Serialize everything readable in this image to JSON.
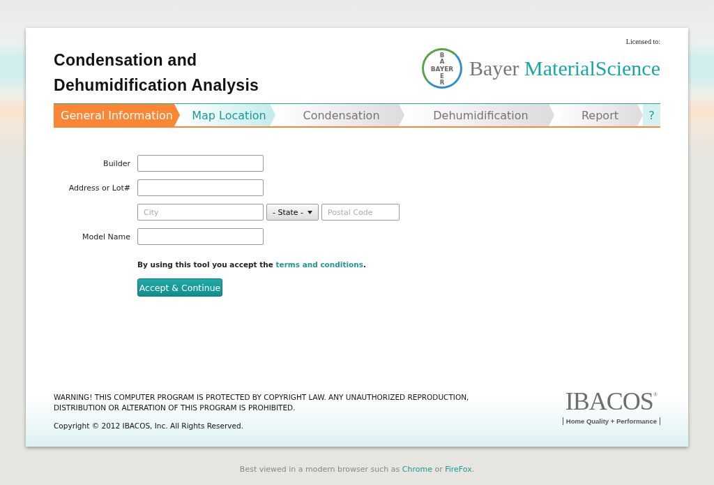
{
  "header": {
    "title_lines": [
      "Condensation and",
      "Dehumidification Analysis"
    ],
    "licensed": "Licensed to:",
    "logo": {
      "horizontal": "BAYER",
      "vertical_top": "BA",
      "vertical_bottom": "ER",
      "brand": "Bayer",
      "brand_accent": "MaterialScience"
    }
  },
  "tabs": [
    {
      "label": "General Information",
      "selected": true,
      "available": true
    },
    {
      "label": "Map Location",
      "selected": false,
      "available": true
    },
    {
      "label": "Condensation",
      "selected": false,
      "available": false
    },
    {
      "label": "Dehumidification",
      "selected": false,
      "available": false
    },
    {
      "label": "Report",
      "selected": false,
      "available": false
    }
  ],
  "help": "?",
  "form": {
    "rows": [
      {
        "kind": "text",
        "label": "Builder"
      },
      {
        "kind": "text",
        "label": "Address or Lot#"
      },
      {
        "kind": "location",
        "city": {
          "placeholder": "City"
        },
        "state": "- State -",
        "postal": {
          "placeholder": "Postal Code"
        }
      },
      {
        "kind": "text",
        "label": "Model Name"
      }
    ],
    "terms": {
      "before": "By using this tool you accept the",
      "link": "terms and conditions",
      "after": "."
    },
    "button": "Accept & Continue"
  },
  "footer": {
    "warning": "WARNING! THIS COMPUTER PROGRAM IS PROTECTED BY COPYRIGHT LAW. ANY UNAUTHORIZED REPRODUCTION, DISTRIBUTION OR ALTERATION OF THIS PROGRAM IS PROHIBITED.",
    "copyright": "Copyright © 2012 IBACOS, Inc. All Rights Reserved.",
    "logo": {
      "name": "IBACOS",
      "mark": "®",
      "tagline": "Home Quality + Performance"
    }
  },
  "note": {
    "before": "Best viewed in a modern browser such as",
    "link1": "Chrome",
    "middle": "or",
    "link2": "FireFox",
    "after": "."
  }
}
